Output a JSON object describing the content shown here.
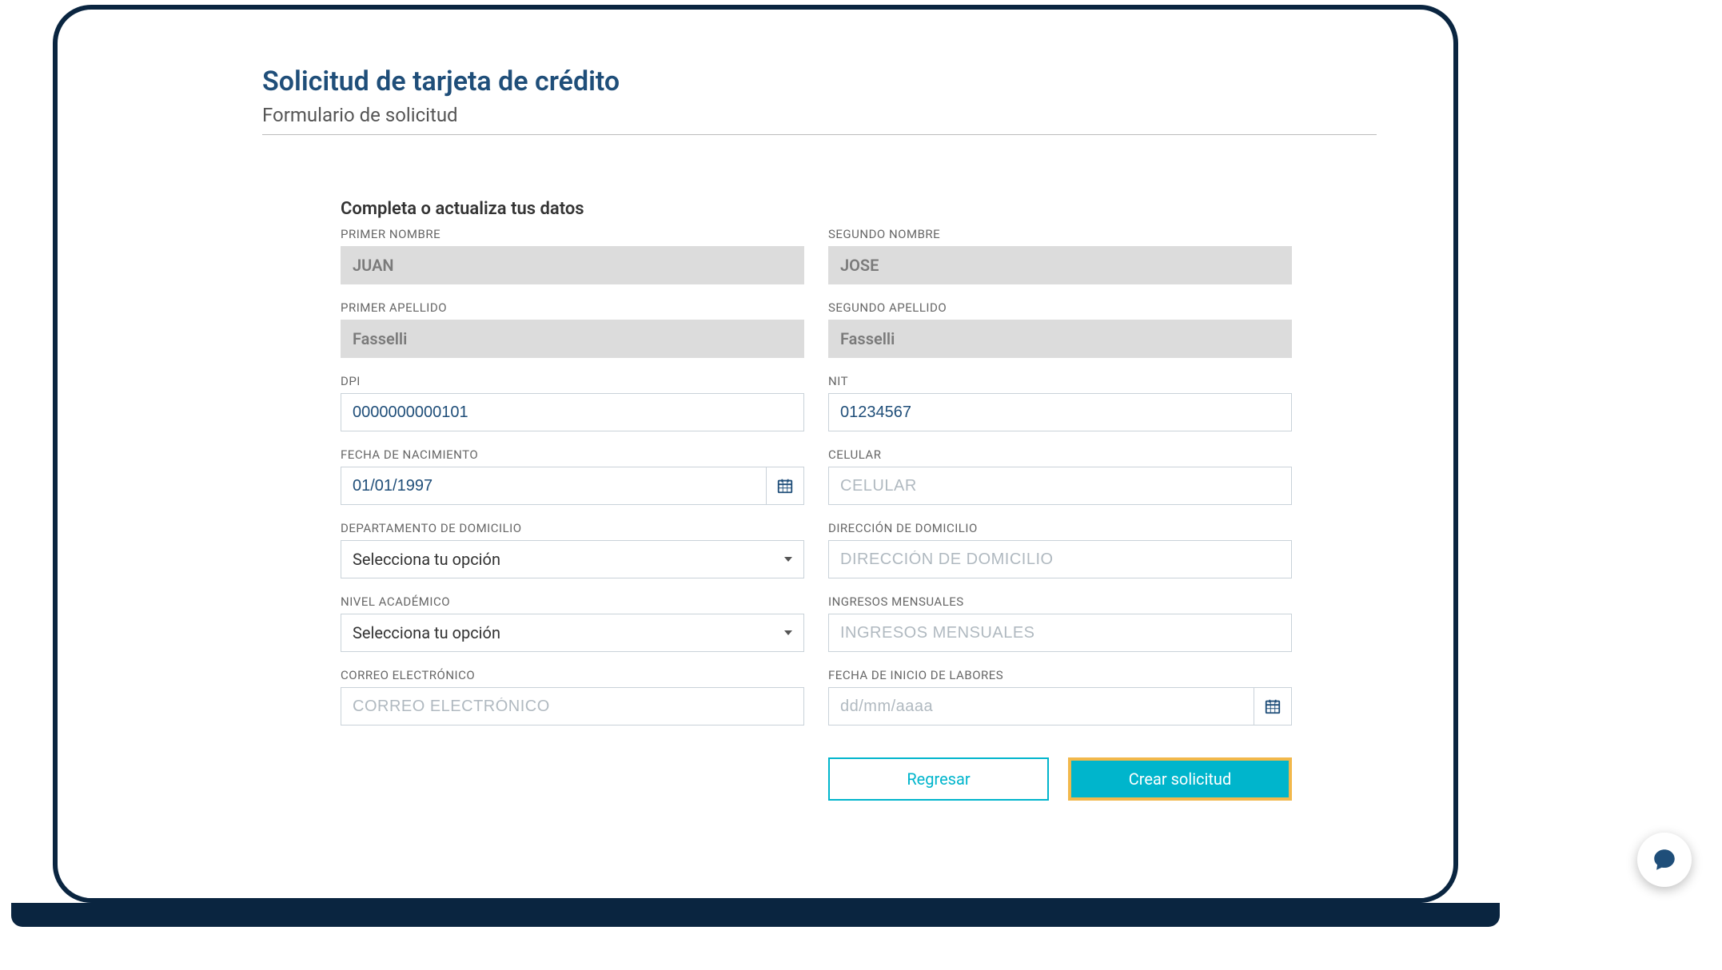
{
  "header": {
    "title": "Solicitud de tarjeta de crédito",
    "subtitle": "Formulario de solicitud"
  },
  "section": {
    "heading": "Completa o actualiza tus datos"
  },
  "fields": {
    "primer_nombre": {
      "label": "PRIMER NOMBRE",
      "value": "JUAN"
    },
    "segundo_nombre": {
      "label": "SEGUNDO NOMBRE",
      "value": "JOSE"
    },
    "primer_apellido": {
      "label": "PRIMER APELLIDO",
      "value": "Fasselli"
    },
    "segundo_apellido": {
      "label": "SEGUNDO APELLIDO",
      "value": "Fasselli"
    },
    "dpi": {
      "label": "DPI",
      "value": "0000000000101"
    },
    "nit": {
      "label": "NIT",
      "value": "01234567"
    },
    "fecha_nacimiento": {
      "label": "FECHA DE NACIMIENTO",
      "value": "01/01/1997"
    },
    "celular": {
      "label": "CELULAR",
      "placeholder": "CELULAR",
      "value": ""
    },
    "departamento": {
      "label": "DEPARTAMENTO DE DOMICILIO",
      "selected": "Selecciona tu opción"
    },
    "direccion": {
      "label": "DIRECCIÓN DE DOMICILIO",
      "placeholder": "DIRECCIÓN DE DOMICILIO",
      "value": ""
    },
    "nivel_academico": {
      "label": "NIVEL ACADÉMICO",
      "selected": "Selecciona tu opción"
    },
    "ingresos": {
      "label": "INGRESOS MENSUALES",
      "placeholder": "INGRESOS MENSUALES",
      "value": ""
    },
    "correo": {
      "label": "CORREO ELECTRÓNICO",
      "placeholder": "CORREO ELECTRÓNICO",
      "value": ""
    },
    "fecha_inicio_labores": {
      "label": "FECHA DE INICIO DE LABORES",
      "placeholder": "dd/mm/aaaa",
      "value": ""
    }
  },
  "buttons": {
    "back": "Regresar",
    "submit": "Crear solicitud"
  },
  "icons": {
    "calendar": "calendar-icon",
    "chat": "chat-icon"
  }
}
